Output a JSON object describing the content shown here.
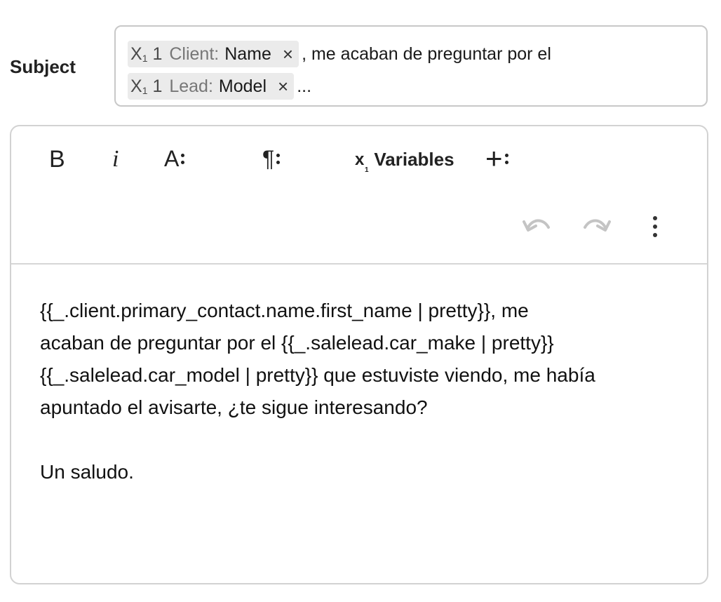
{
  "subject": {
    "label": "Subject",
    "chips": [
      {
        "var_label": "X",
        "var_sub": "1",
        "var_num": "1",
        "prefix": "Client:",
        "name": "Name",
        "remove": "×"
      },
      {
        "var_label": "X",
        "var_sub": "1",
        "var_num": "1",
        "prefix": "Lead:",
        "name": "Model",
        "remove": "×"
      }
    ],
    "text_after_first": ", me acaban de preguntar por el",
    "text_after_second": "..."
  },
  "toolbar": {
    "bold": "B",
    "italic": "i",
    "font": "A",
    "paragraph": "¶",
    "variables_x": "x",
    "variables_sub": "1",
    "variables_label": "Variables",
    "plus": "+"
  },
  "body": {
    "lines": [
      "{{_.client.primary_contact.name.first_name | pretty}}, me",
      "acaban de preguntar por el {{_.salelead.car_make | pretty}}",
      "{{_.salelead.car_model | pretty}} que estuviste viendo, me había",
      "apuntado el avisarte, ¿te sigue interesando?"
    ],
    "closing": "Un saludo."
  }
}
